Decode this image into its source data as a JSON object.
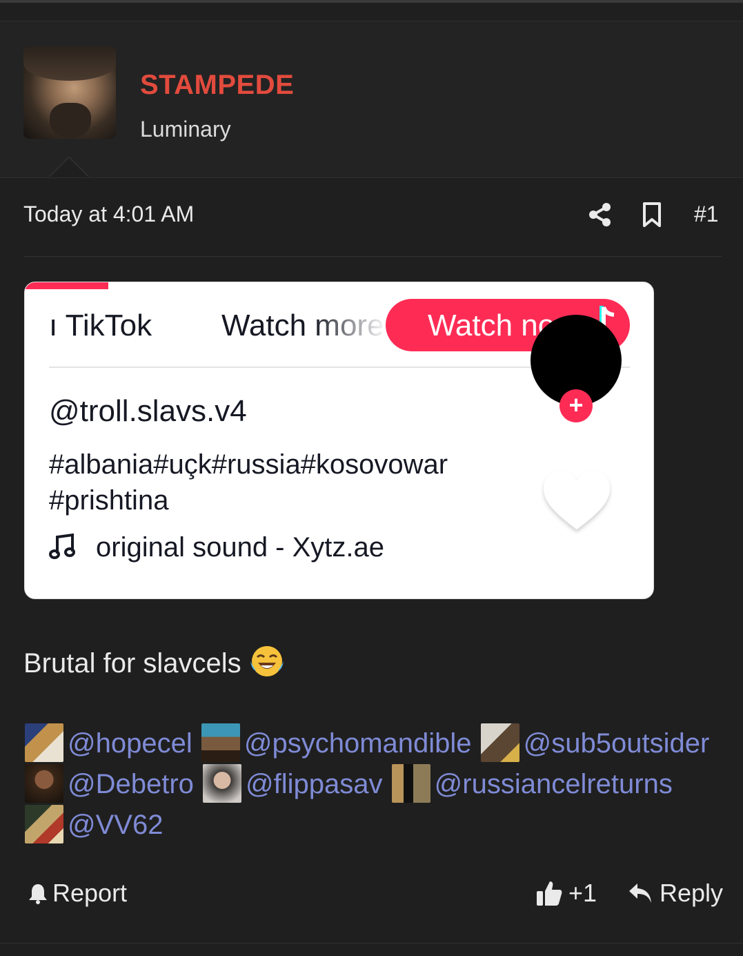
{
  "user": {
    "name": "STAMPEDE",
    "title": "Luminary"
  },
  "post": {
    "timestamp": "Today at 4:01 AM",
    "number": "#1",
    "body": "Brutal for slavcels",
    "emoji": "face-with-tears-of-joy",
    "mentions": [
      {
        "name": "@hopecel",
        "thumb": "t1"
      },
      {
        "name": "@psychomandible",
        "thumb": "t2"
      },
      {
        "name": "@sub5outsider",
        "thumb": "t3"
      },
      {
        "name": "@Debetro",
        "thumb": "t4"
      },
      {
        "name": "@flippasav",
        "thumb": "t5"
      },
      {
        "name": "@russiancelreturns",
        "thumb": "t6"
      },
      {
        "name": "@VV62",
        "thumb": "t7"
      }
    ]
  },
  "embed": {
    "tab_left": "ı TikTok",
    "tab_middle": "Watch more",
    "watch_button": "Watch now",
    "author": "@troll.slavs.v4",
    "caption": "#albania#uçk#russia#kosovowar #prishtina",
    "sound": "original sound - Xytz.ae",
    "follow_symbol": "+",
    "progress_color": "#fe2c55"
  },
  "actions": {
    "report": "Report",
    "like_count": "+1",
    "reply": "Reply"
  },
  "colors": {
    "background": "#1f1f1f",
    "username": "#e24b3d",
    "mention": "#7f8bd6",
    "tiktok_accent": "#fe2c55"
  }
}
